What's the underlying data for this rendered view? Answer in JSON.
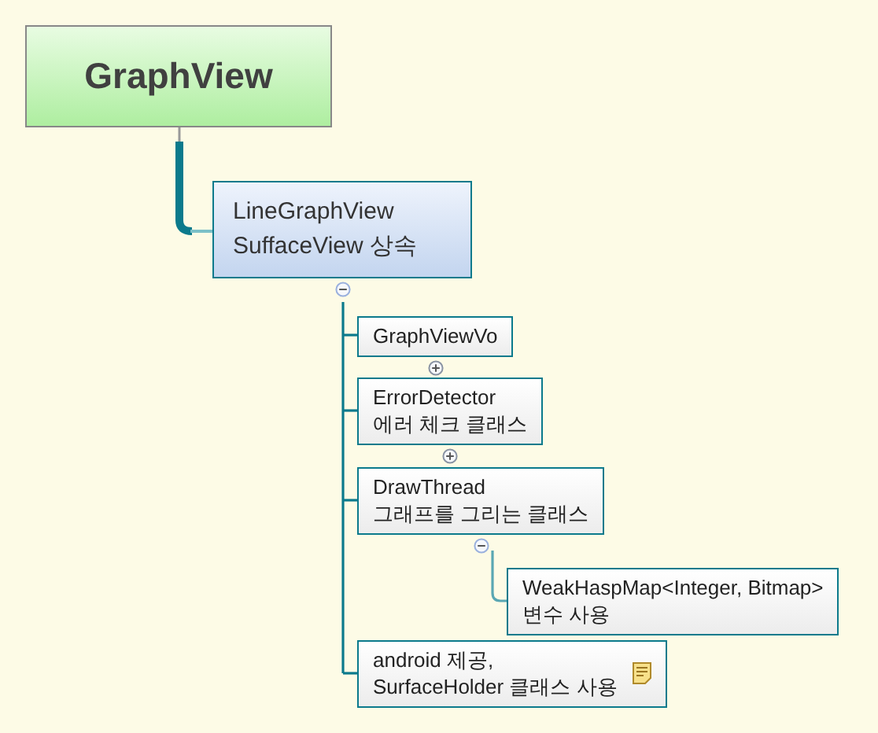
{
  "root": {
    "text": "GraphView"
  },
  "main": {
    "text": "LineGraphView\nSuffaceView 상속",
    "expanded": true,
    "children": [
      {
        "text": "GraphViewVo",
        "expanded": false
      },
      {
        "text": "ErrorDetector\n에러 체크 클래스",
        "expanded": false
      },
      {
        "text": "DrawThread\n그래프를 그리는 클래스",
        "expanded": true,
        "children": [
          {
            "text": "WeakHaspMap<Integer, Bitmap>\n변수 사용"
          }
        ]
      },
      {
        "text": "android 제공,\nSurfaceHolder 클래스 사용",
        "note": true
      }
    ]
  }
}
